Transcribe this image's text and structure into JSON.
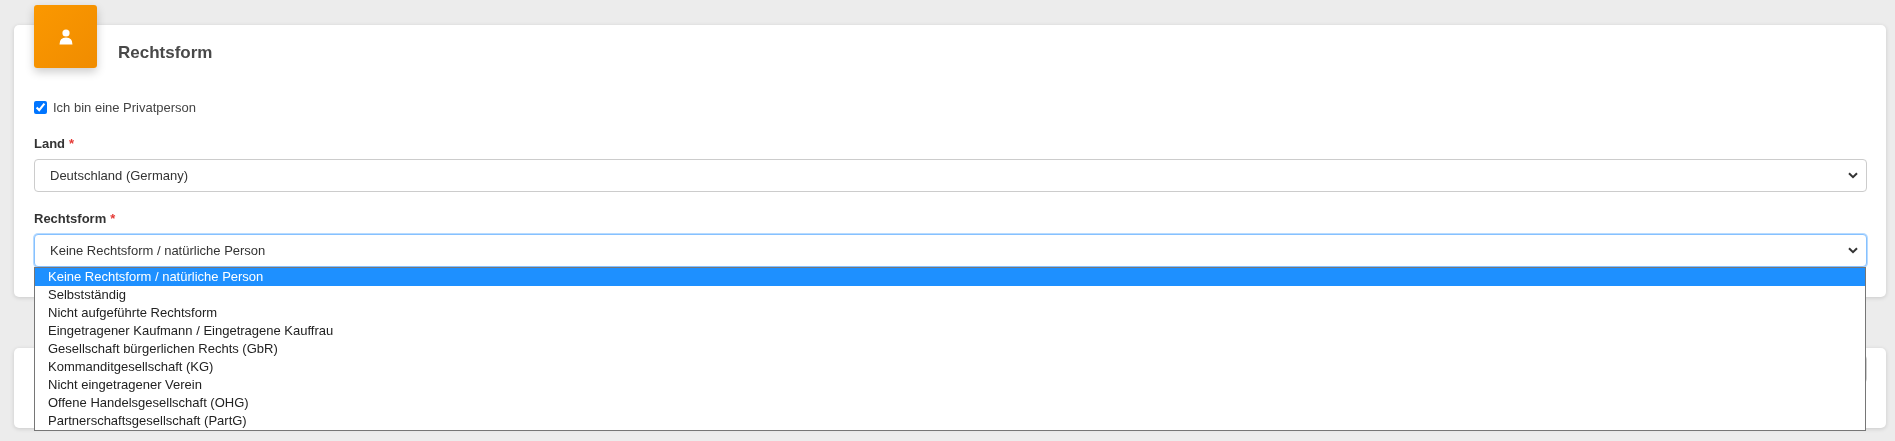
{
  "header": {
    "title": "Rechtsform"
  },
  "private_person": {
    "label": "Ich bin eine Privatperson",
    "checked": true
  },
  "fields": [
    {
      "label": "Land",
      "required_mark": "*",
      "value": "Deutschland (Germany)",
      "focused": false
    },
    {
      "label": "Rechtsform",
      "required_mark": "*",
      "value": "Keine Rechtsform / natürliche Person",
      "focused": true,
      "expanded": true,
      "options": [
        {
          "label": "Keine Rechtsform / natürliche Person",
          "selected": true
        },
        {
          "label": "Selbstständig",
          "selected": false
        },
        {
          "label": "Nicht aufgeführte Rechtsform",
          "selected": false
        },
        {
          "label": "Eingetragener Kaufmann / Eingetragene Kauffrau",
          "selected": false
        },
        {
          "label": "Gesellschaft bürgerlichen Rechts (GbR)",
          "selected": false
        },
        {
          "label": "Kommanditgesellschaft (KG)",
          "selected": false
        },
        {
          "label": "Nicht eingetragener Verein",
          "selected": false
        },
        {
          "label": "Offene Handelsgesellschaft (OHG)",
          "selected": false
        },
        {
          "label": "Partnerschaftsgesellschaft (PartG)",
          "selected": false
        }
      ]
    }
  ]
}
